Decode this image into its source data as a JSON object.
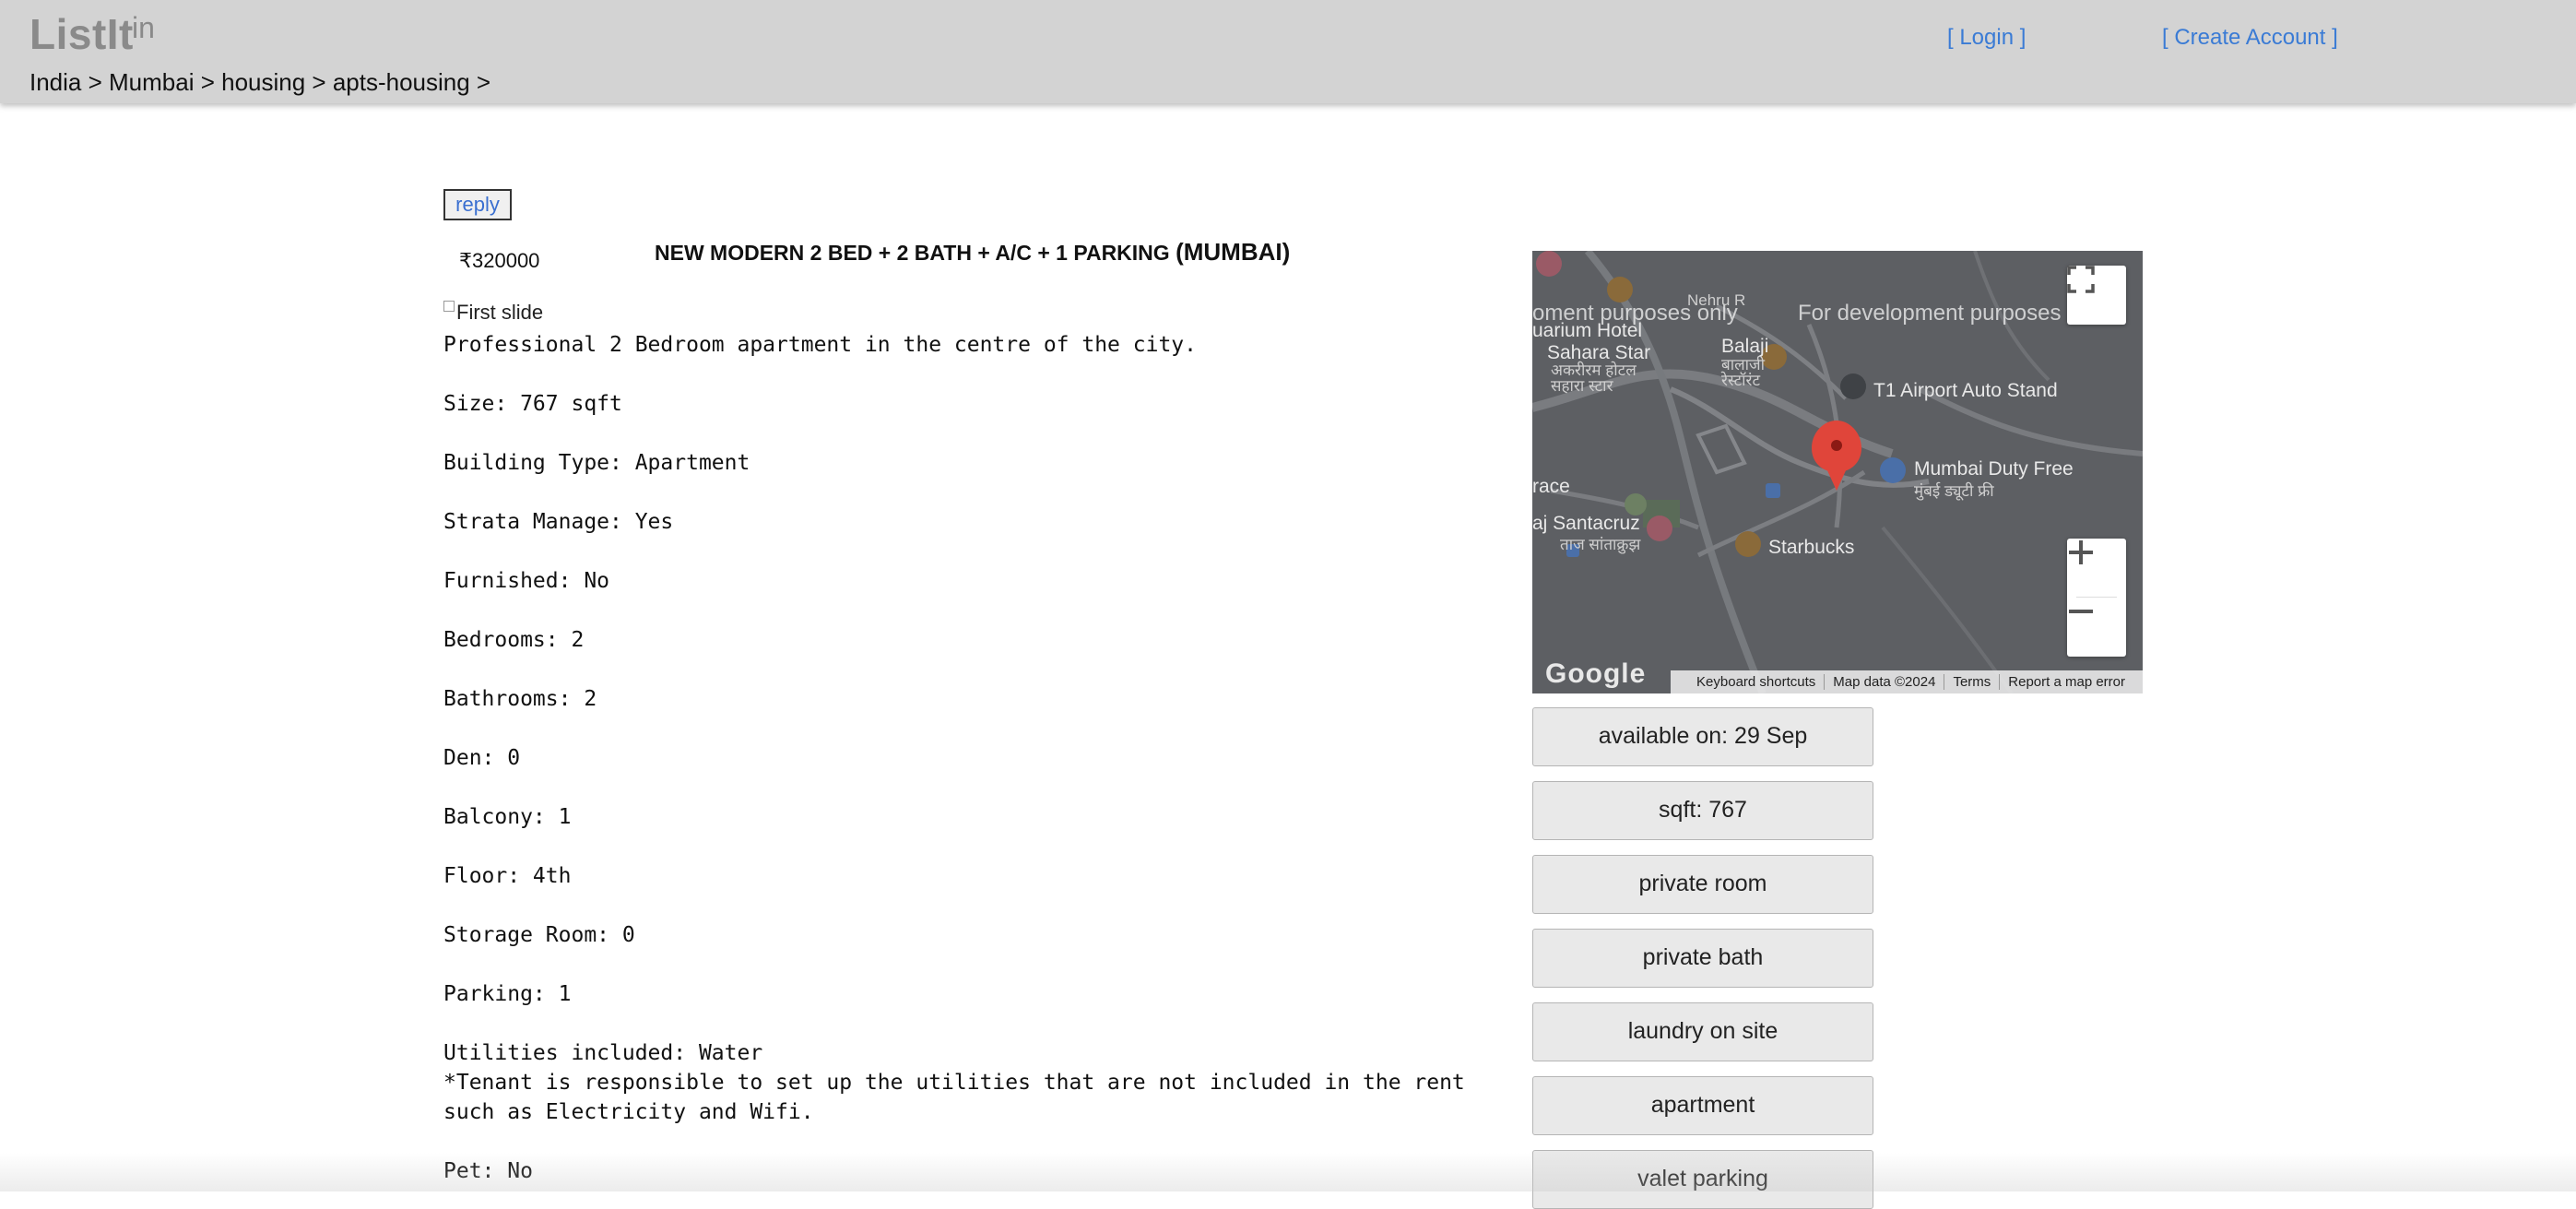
{
  "header": {
    "logo": "ListIt",
    "logo_superscript": "in",
    "breadcrumb": "India > Mumbai > housing > apts-housing >",
    "login_link": "[ Login ]",
    "create_account_link": "[ Create Account ]"
  },
  "listing": {
    "reply_label": "reply",
    "price": "₹320000",
    "title": "NEW MODERN 2 BED + 2 BATH + A/C + 1 PARKING",
    "location": "(MUMBAI)",
    "image_alt": "First slide",
    "description": "Professional 2 Bedroom apartment in the centre of the city.\n\nSize: 767 sqft\n\nBuilding Type: Apartment\n\nStrata Manage: Yes\n\nFurnished: No\n\nBedrooms: 2\n\nBathrooms: 2\n\nDen: 0\n\nBalcony: 1\n\nFloor: 4th\n\nStorage Room: 0\n\nParking: 1\n\nUtilities included: Water\n*Tenant is responsible to set up the utilities that are not included in the rent\nsuch as Electricity and Wifi.\n\nPet: No"
  },
  "map": {
    "dev_watermark_left": "oment purposes only",
    "dev_watermark_right": "For development purposes",
    "labels": {
      "nehru": "Nehru R",
      "hotel": "uarium Hotel",
      "sahara": "Sahara Star",
      "sahara_hi": "अकरीरम होटल सहारा स्टार",
      "balaji": "Balaji",
      "balaji_hi": "बालाजी रेस्टॉरंट",
      "t1": "T1 Airport Auto Stand",
      "duty_free": "Mumbai Duty Free",
      "duty_free_hi": "मुंबई ड्यूटी फ्री",
      "race": "race",
      "santacruz": "aj Santacruz",
      "santacruz_hi": "ताज सांताक्रुझ",
      "starbucks": "Starbucks",
      "google": "Google"
    },
    "footer": {
      "shortcuts": "Keyboard shortcuts",
      "map_data": "Map data ©2024",
      "terms": "Terms",
      "report": "Report a map error"
    }
  },
  "attributes": [
    "available on: 29 Sep",
    "sqft: 767",
    "private room",
    "private bath",
    "laundry on site",
    "apartment",
    "valet parking"
  ],
  "colors": {
    "header_bg": "#d3d3d3",
    "link": "#3a7bd5",
    "map_bg": "#5d5f63",
    "marker": "#e0453a"
  }
}
